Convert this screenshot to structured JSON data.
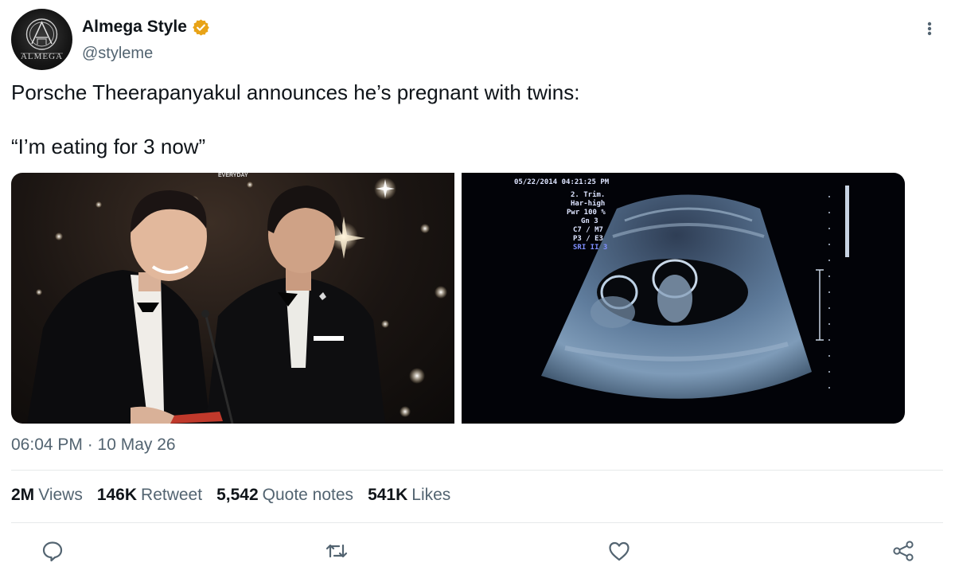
{
  "author": {
    "name": "Almega Style",
    "handle": "@styleme",
    "avatar_text": "ALMEGA",
    "verified_color": "#e8a317"
  },
  "tweet": {
    "line1": "Porsche Theerapanyakul announces he’s pregnant with twins:",
    "line2": "“I’m eating for 3 now”"
  },
  "media": {
    "left_watermark": "EVERYDAY",
    "ultrasound": {
      "datetime": "05/22/2014  04:21:25 PM",
      "settings": [
        "2. Trim.",
        "Har-high",
        "Pwr 100 %",
        "Gn  3",
        "C7 / M7",
        "P3 / E3",
        "SRI II 3"
      ],
      "highlight_color": "#7f8fff"
    }
  },
  "timestamp": "06:04 PM · 10 May 26",
  "stats": [
    {
      "num": "2M",
      "label": "Views"
    },
    {
      "num": "146K",
      "label": "Retweet"
    },
    {
      "num": "5,542",
      "label": "Quote notes"
    },
    {
      "num": "541K",
      "label": "Likes"
    }
  ],
  "actions": [
    "reply-icon",
    "retweet-icon",
    "like-icon",
    "share-icon"
  ],
  "colors": {
    "text": "#0f1419",
    "secondary": "#536471",
    "divider": "#e6e9ea"
  }
}
